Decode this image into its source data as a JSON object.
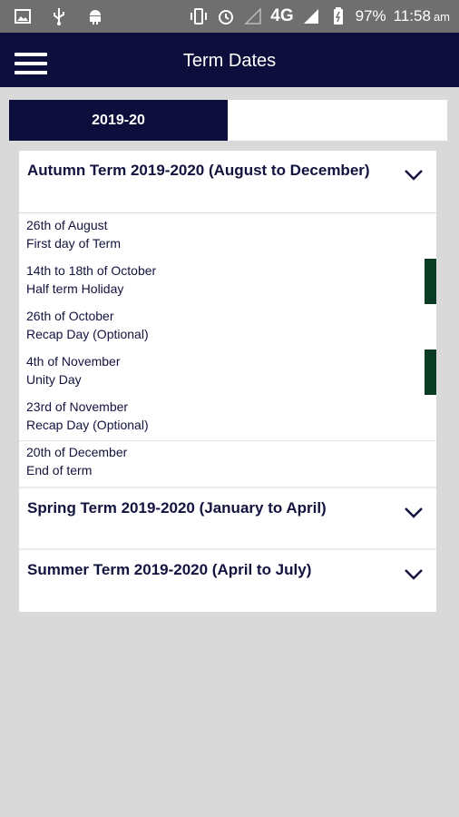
{
  "status_bar": {
    "network": "4G",
    "battery": "97%",
    "time": "11:58",
    "ampm": "am",
    "icons": [
      "image-icon",
      "usb-icon",
      "android-icon",
      "vibrate-icon",
      "alarm-icon",
      "signal-icon",
      "battery-icon"
    ]
  },
  "app_bar": {
    "title": "Term Dates"
  },
  "tabs": [
    {
      "label": "2019-20",
      "active": true
    },
    {
      "label": "",
      "active": false
    }
  ],
  "terms": [
    {
      "title": "Autumn Term 2019-2020 (August to December)",
      "expanded": true,
      "entries": [
        {
          "date": "26th of August",
          "desc": "First day of Term"
        },
        {
          "date": "14th to 18th of October",
          "desc": "Half term Holiday"
        },
        {
          "date": "26th of October",
          "desc": "Recap Day (Optional)"
        },
        {
          "date": "4th of November",
          "desc": "Unity Day"
        },
        {
          "date": "23rd of November",
          "desc": "Recap Day (Optional)"
        },
        {
          "date": "20th of December",
          "desc": "End of term"
        }
      ]
    },
    {
      "title": "Spring Term 2019-2020 (January to April)",
      "expanded": false
    },
    {
      "title": "Summer Term 2019-2020 (April to July)",
      "expanded": false
    }
  ],
  "colors": {
    "navy": "#0e0e3c",
    "marker_green": "#0a3b24",
    "background": "#d9d9d9"
  }
}
